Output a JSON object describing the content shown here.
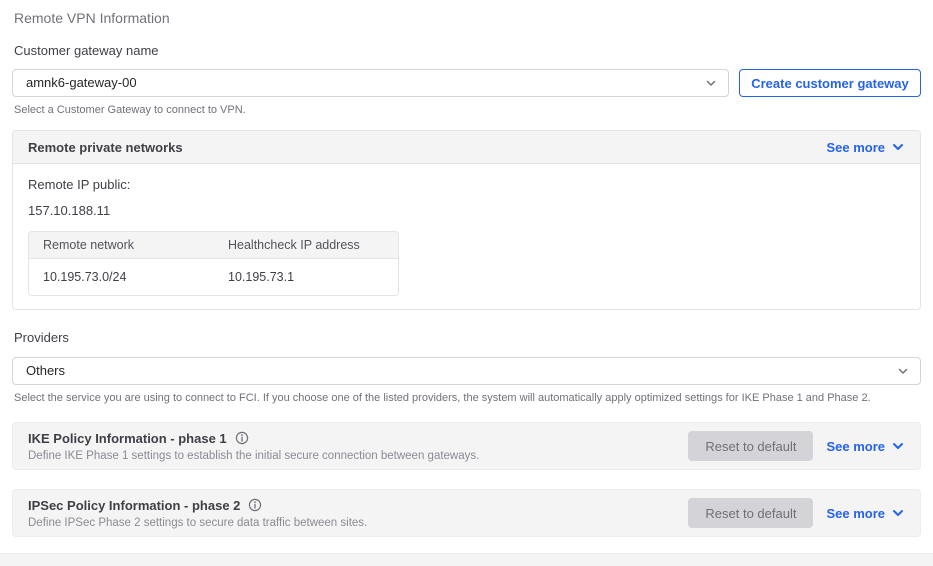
{
  "page": {
    "title": "Remote VPN Information"
  },
  "customer_gateway": {
    "label": "Customer gateway name",
    "selected_value": "amnk6-gateway-00",
    "create_button_label": "Create customer gateway",
    "helper_text": "Select a Customer Gateway to connect to VPN."
  },
  "remote_private_networks": {
    "title": "Remote private networks",
    "see_more_label": "See more",
    "remote_ip_public_label": "Remote IP public:",
    "remote_ip_public_value": "157.10.188.11",
    "table": {
      "columns": [
        "Remote network",
        "Healthcheck IP address"
      ],
      "rows": [
        [
          "10.195.73.0/24",
          "10.195.73.1"
        ]
      ]
    }
  },
  "providers": {
    "label": "Providers",
    "selected_value": "Others",
    "helper_text": "Select the service you are using to connect to FCI. If you choose one of the listed providers, the system will automatically apply optimized settings for IKE Phase 1 and Phase 2."
  },
  "ike_policy": {
    "title": "IKE Policy Information - phase 1",
    "description": "Define IKE Phase 1 settings to establish the initial secure connection between gateways.",
    "reset_button_label": "Reset to default",
    "see_more_label": "See more"
  },
  "ipsec_policy": {
    "title": "IPSec Policy Information - phase 2",
    "description": "Define IPSec Phase 2 settings to secure data traffic between sites.",
    "reset_button_label": "Reset to default",
    "see_more_label": "See more"
  },
  "icons": {
    "chevron_down_icon": "∨",
    "info_icon": "ⓘ"
  },
  "colors": {
    "accent_blue": "#2563eb",
    "panel_gray": "#f4f4f5",
    "border_gray": "#e4e4e7",
    "input_border": "#d4d4d8",
    "text_dark": "#3f3f46",
    "text_muted": "#71717a",
    "disabled_button_bg": "#d4d4d8"
  }
}
